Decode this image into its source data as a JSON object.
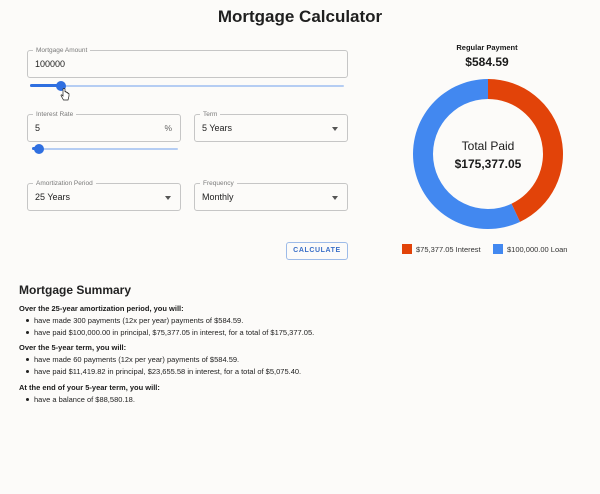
{
  "page": {
    "title": "Mortgage Calculator"
  },
  "form": {
    "mortgage_amount": {
      "label": "Mortgage Amount",
      "value": "100000",
      "slider_fraction": 0.1
    },
    "interest_rate": {
      "label": "Interest Rate",
      "value": "5",
      "suffix": "%",
      "slider_fraction": 0.05
    },
    "term": {
      "label": "Term",
      "value": "5 Years"
    },
    "amortization": {
      "label": "Amortization Period",
      "value": "25 Years"
    },
    "frequency": {
      "label": "Frequency",
      "value": "Monthly"
    },
    "calculate_label": "CALCULATE"
  },
  "results": {
    "regular_payment_label": "Regular Payment",
    "regular_payment": "$584.59",
    "total_paid_label": "Total Paid",
    "total_paid": "$175,377.05",
    "legend": [
      {
        "label": "$75,377.05 Interest",
        "color": "#e24309"
      },
      {
        "label": "$100,000.00 Loan",
        "color": "#4288f0"
      }
    ]
  },
  "chart_data": {
    "type": "pie",
    "categories": [
      "Interest",
      "Loan"
    ],
    "values": [
      75377.05,
      100000.0
    ],
    "colors": [
      "#e24309",
      "#4288f0"
    ],
    "title": "",
    "legend_position": "bottom"
  },
  "summary": {
    "title": "Mortgage Summary",
    "sections": [
      {
        "heading": "Over the 25-year amortization period, you will:",
        "items": [
          "have made 300 payments (12x per year) payments of $584.59.",
          "have paid $100,000.00 in principal, $75,377.05 in interest, for a total of $175,377.05."
        ]
      },
      {
        "heading": "Over the 5-year term, you will:",
        "items": [
          "have made 60 payments (12x per year) payments of $584.59.",
          "have paid $11,419.82 in principal, $23,655.58 in interest, for a total of $5,075.40."
        ]
      },
      {
        "heading": "At the end of your 5-year term, you will:",
        "items": [
          "have a balance of $88,580.18."
        ]
      }
    ]
  }
}
